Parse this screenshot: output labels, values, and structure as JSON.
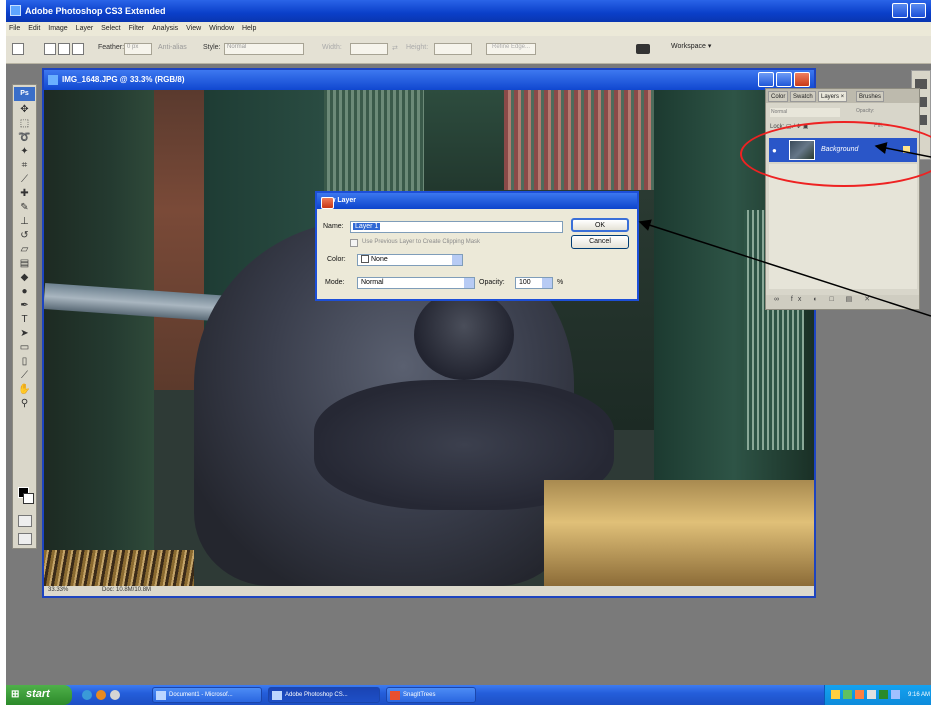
{
  "app": {
    "title": "Adobe Photoshop CS3 Extended"
  },
  "menu": [
    "File",
    "Edit",
    "Image",
    "Layer",
    "Select",
    "Filter",
    "Analysis",
    "View",
    "Window",
    "Help"
  ],
  "options_bar": {
    "feather_label": "Feather:",
    "feather_value": "0 px",
    "anti_alias_label": "Anti-alias",
    "style_label": "Style:",
    "style_value": "Normal",
    "width_label": "Width:",
    "height_label": "Height:",
    "refine_edge": "Refine Edge...",
    "workspace": "Workspace ▾"
  },
  "document": {
    "title": "IMG_1648.JPG @ 33.3% (RGB/8)",
    "zoom": "33.33%",
    "doc_info": "Doc: 10.8M/10.8M"
  },
  "new_layer_dialog": {
    "title": "New Layer",
    "name_label": "Name:",
    "name_value": "Layer 1",
    "use_previous": "Use Previous Layer to Create Clipping Mask",
    "color_label": "Color:",
    "color_value": "None",
    "mode_label": "Mode:",
    "mode_value": "Normal",
    "opacity_label": "Opacity:",
    "opacity_value": "100",
    "opacity_unit": "%",
    "ok": "OK",
    "cancel": "Cancel"
  },
  "layers_panel": {
    "tabs": [
      "Color",
      "Swatch",
      "Layers ×",
      "Brushes"
    ],
    "blend_mode": "Normal",
    "opacity_label": "Opacity:",
    "lock_label": "Lock:",
    "fill_label": "Fill:",
    "layer_name": "Background",
    "footer_icons": "∞ fx ◐ □ ▤ ✕"
  },
  "taskbar": {
    "start": "start",
    "tasks": [
      "Document1 - Microsof...",
      "Adobe Photoshop CS...",
      "SnagItTrees"
    ],
    "clock": "9:16 AM"
  },
  "colors": {
    "xp_blue": "#245edb",
    "annotation_red": "#e22222"
  }
}
